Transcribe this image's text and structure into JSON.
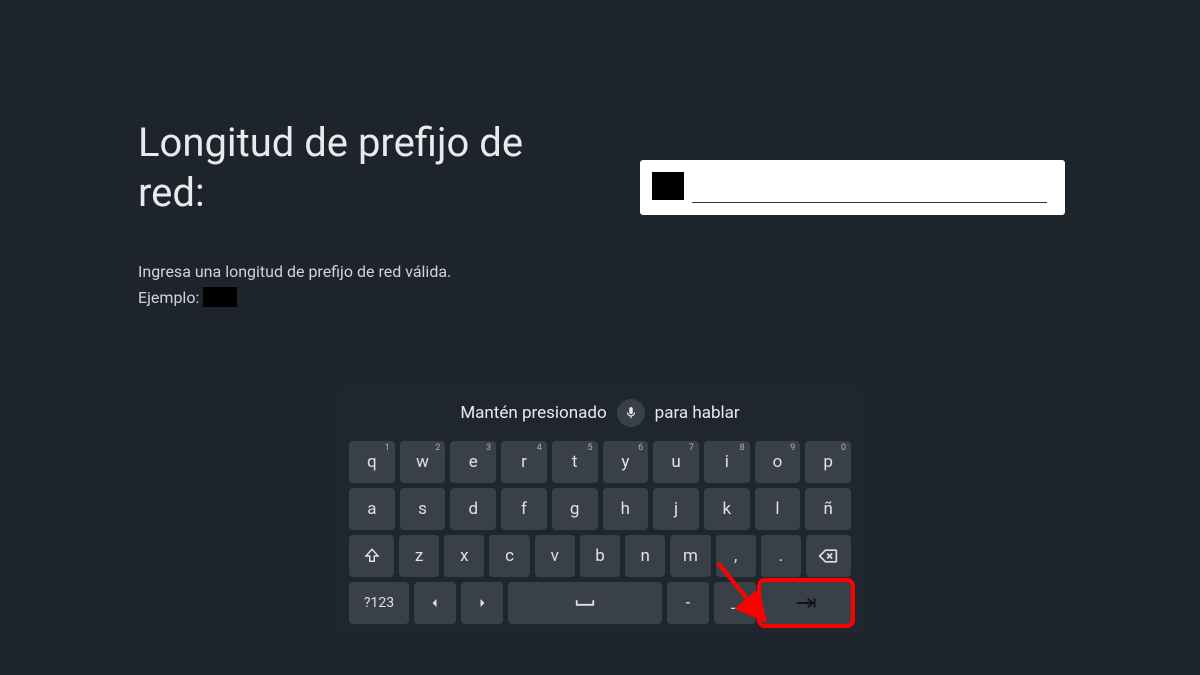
{
  "title": "Longitud de prefijo de red:",
  "subtitle": "Ingresa una longitud de prefijo de red válida.",
  "example_label": "Ejemplo:",
  "hint_before": "Mantén presionado",
  "hint_after": "para hablar",
  "keyboard": {
    "row1": [
      {
        "l": "q",
        "s": "1"
      },
      {
        "l": "w",
        "s": "2"
      },
      {
        "l": "e",
        "s": "3"
      },
      {
        "l": "r",
        "s": "4"
      },
      {
        "l": "t",
        "s": "5"
      },
      {
        "l": "y",
        "s": "6"
      },
      {
        "l": "u",
        "s": "7"
      },
      {
        "l": "i",
        "s": "8"
      },
      {
        "l": "o",
        "s": "9"
      },
      {
        "l": "p",
        "s": "0"
      }
    ],
    "row2": [
      "a",
      "s",
      "d",
      "f",
      "g",
      "h",
      "j",
      "k",
      "l",
      "ñ"
    ],
    "row3": [
      "z",
      "x",
      "c",
      "v",
      "b",
      "n",
      "m",
      ","
    ],
    "period": ".",
    "sym_label": "?123",
    "dash": "-",
    "underscore": "_"
  }
}
